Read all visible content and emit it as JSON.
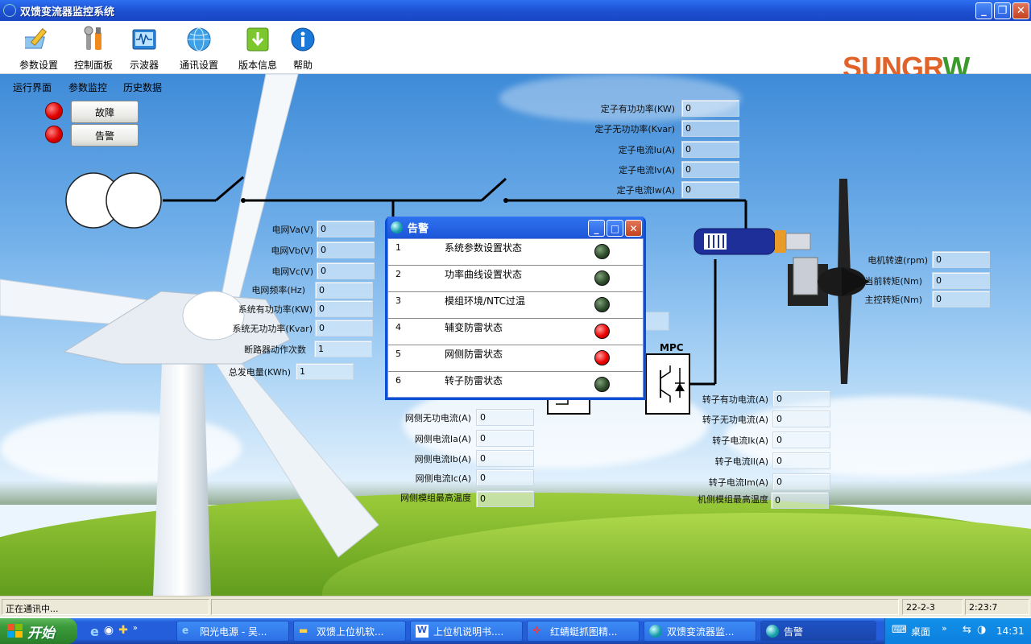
{
  "window": {
    "title": "双馈变流器监控系统"
  },
  "toolbar": {
    "items": [
      {
        "label": "参数设置",
        "icon": "pencil-paper-icon"
      },
      {
        "label": "控制面板",
        "icon": "tools-icon"
      },
      {
        "label": "示波器",
        "icon": "oscilloscope-icon"
      },
      {
        "label": "通讯设置",
        "icon": "globe-network-icon"
      },
      {
        "label": "版本信息",
        "icon": "download-arrow-icon"
      },
      {
        "label": "帮助",
        "icon": "info-icon"
      }
    ],
    "logo_text_a": "SUNGR",
    "logo_text_b": "W",
    "logo_color": "#e0632a",
    "logo_color2": "#3b9a2c"
  },
  "tabs": [
    "运行界面",
    "参数监控",
    "历史数据"
  ],
  "status_buttons": {
    "fault": "故障",
    "alarm": "告警"
  },
  "stator": {
    "rows": [
      {
        "label": "定子有功功率(KW)",
        "value": "0"
      },
      {
        "label": "定子无功功率(Kvar)",
        "value": "0"
      },
      {
        "label": "定子电流Iu(A)",
        "value": "0"
      },
      {
        "label": "定子电流Iv(A)",
        "value": "0"
      },
      {
        "label": "定子电流Iw(A)",
        "value": "0"
      }
    ]
  },
  "grid": {
    "rows": [
      {
        "label": "电网Va(V)",
        "value": "0"
      },
      {
        "label": "电网Vb(V)",
        "value": "0"
      },
      {
        "label": "电网Vc(V)",
        "value": "0"
      },
      {
        "label": "电网频率(Hz)",
        "value": "0"
      },
      {
        "label": "系统有功功率(KW)",
        "value": "0"
      },
      {
        "label": "系统无功功率(Kvar)",
        "value": "0"
      },
      {
        "label": "断路器动作次数",
        "value": "1"
      },
      {
        "label": "总发电量(KWh)",
        "value": "1"
      }
    ]
  },
  "gridside": {
    "rows": [
      {
        "label": "网侧无功电流(A)",
        "value": "0"
      },
      {
        "label": "网侧电流Ia(A)",
        "value": "0"
      },
      {
        "label": "网侧电流Ib(A)",
        "value": "0"
      },
      {
        "label": "网侧电流Ic(A)",
        "value": "0"
      },
      {
        "label": "网侧模组最高温度",
        "value": "0"
      }
    ]
  },
  "rotor": {
    "rows": [
      {
        "label": "转子有功电流(A)",
        "value": "0"
      },
      {
        "label": "转子无功电流(A)",
        "value": "0"
      },
      {
        "label": "转子电流Ik(A)",
        "value": "0"
      },
      {
        "label": "转子电流Il(A)",
        "value": "0"
      },
      {
        "label": "转子电流Im(A)",
        "value": "0"
      },
      {
        "label": "机侧模组最高温度",
        "value": "0"
      }
    ]
  },
  "motor": {
    "rows": [
      {
        "label": "电机转速(rpm)",
        "value": "0"
      },
      {
        "label": "当前转矩(Nm)",
        "value": "0"
      },
      {
        "label": "主控转矩(Nm)",
        "value": "0"
      }
    ]
  },
  "mpc_label": "MPC",
  "alarm_dialog": {
    "title": "告警",
    "items": [
      {
        "num": "1",
        "name": "系统参数设置状态",
        "state": "ok"
      },
      {
        "num": "2",
        "name": "功率曲线设置状态",
        "state": "ok"
      },
      {
        "num": "3",
        "name": "模组环境/NTC过温",
        "state": "ok"
      },
      {
        "num": "4",
        "name": "辅变防雷状态",
        "state": "bad"
      },
      {
        "num": "5",
        "name": "网侧防雷状态",
        "state": "bad"
      },
      {
        "num": "6",
        "name": "转子防雷状态",
        "state": "ok"
      }
    ]
  },
  "status": {
    "text": "正在通讯中...",
    "date": "22-2-3",
    "time": "2:23:7"
  },
  "taskbar": {
    "start": "开始",
    "buttons": [
      "阳光电源 - 吴...",
      "双馈上位机软...",
      "上位机说明书....",
      "红蜻蜓抓图精...",
      "双馈变流器监...",
      "告警"
    ],
    "desktop": "桌面",
    "clock": "14:31"
  },
  "colors": {
    "led_ok": "#2e4d2b",
    "led_bad": "#ee0000",
    "xp_blue": "#245edb"
  }
}
